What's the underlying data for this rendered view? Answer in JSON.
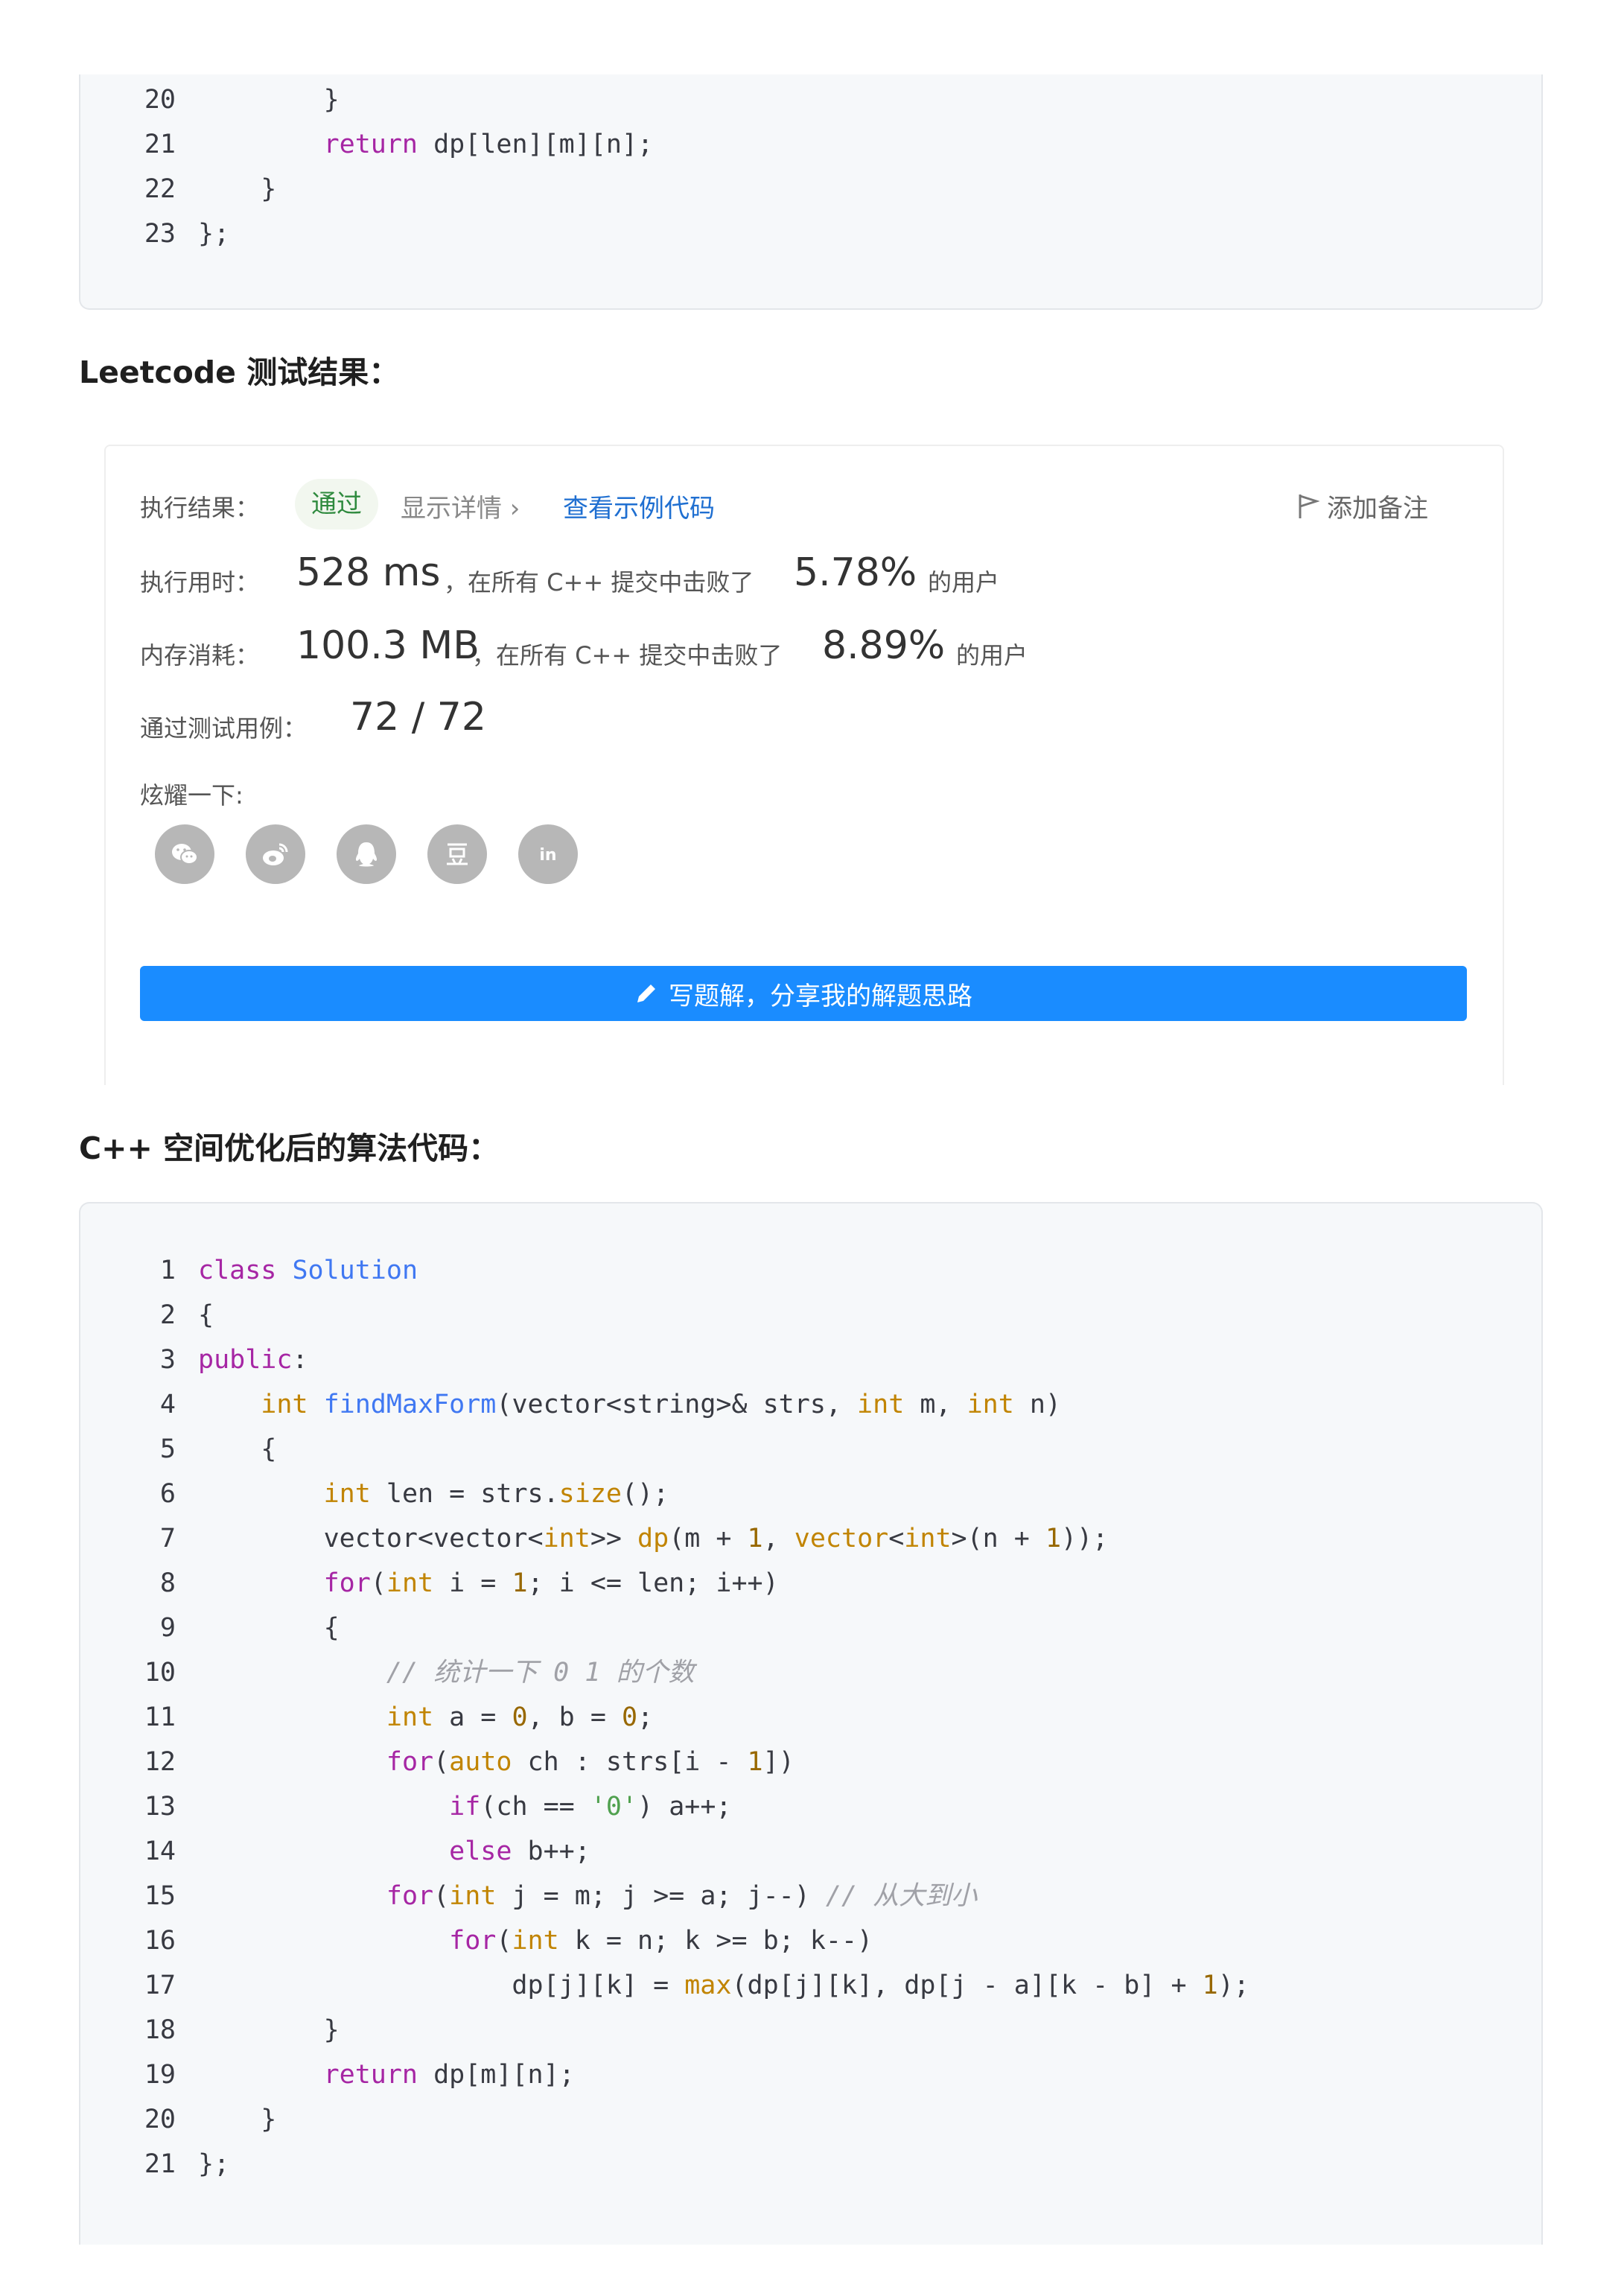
{
  "code_block_1": {
    "lines": [
      {
        "num": "20",
        "tokens": [
          {
            "t": "        }",
            "c": "pl"
          }
        ]
      },
      {
        "num": "21",
        "tokens": [
          {
            "t": "        ",
            "c": "pl"
          },
          {
            "t": "return",
            "c": "kw"
          },
          {
            "t": " dp[len][m][n];",
            "c": "pl"
          }
        ]
      },
      {
        "num": "22",
        "tokens": [
          {
            "t": "    }",
            "c": "pl"
          }
        ]
      },
      {
        "num": "23",
        "tokens": [
          {
            "t": "};",
            "c": "pl"
          }
        ]
      }
    ]
  },
  "heading_results": "Leetcode 测试结果：",
  "result_card": {
    "status_label": "执行结果：",
    "status_value": "通过",
    "details_link": "显示详情 ›",
    "sample_code_link": "查看示例代码",
    "add_note_label": "添加备注",
    "runtime_label": "执行用时：",
    "runtime_value": "528 ms",
    "runtime_mid": "，在所有 C++ 提交中击败了",
    "runtime_percent": "5.78%",
    "runtime_tail": "的用户",
    "memory_label": "内存消耗：",
    "memory_value": "100.3 MB",
    "memory_mid": "，在所有 C++ 提交中击败了",
    "memory_percent": "8.89%",
    "memory_tail": "的用户",
    "tests_label": "通过测试用例：",
    "tests_value": "72 / 72",
    "share_label": "炫耀一下:",
    "share_icons": [
      "wechat-icon",
      "weibo-icon",
      "qq-icon",
      "douban-icon",
      "linkedin-icon"
    ],
    "write_solution_label": "写题解，分享我的解题思路",
    "colors": {
      "button": "#1a8cff",
      "pass": "#2f8a3e",
      "link": "#1f6fd1"
    }
  },
  "heading_optimized": "C++ 空间优化后的算法代码：",
  "code_block_2": {
    "lines": [
      {
        "num": "1",
        "tokens": [
          {
            "t": "class",
            "c": "kw"
          },
          {
            "t": " ",
            "c": "pl"
          },
          {
            "t": "Solution",
            "c": "fn"
          }
        ]
      },
      {
        "num": "2",
        "tokens": [
          {
            "t": "{",
            "c": "pl"
          }
        ]
      },
      {
        "num": "3",
        "tokens": [
          {
            "t": "public",
            "c": "kw"
          },
          {
            "t": ":",
            "c": "pl"
          }
        ]
      },
      {
        "num": "4",
        "tokens": [
          {
            "t": "    ",
            "c": "pl"
          },
          {
            "t": "int",
            "c": "ty"
          },
          {
            "t": " ",
            "c": "pl"
          },
          {
            "t": "findMaxForm",
            "c": "fn"
          },
          {
            "t": "(vector<string>& strs, ",
            "c": "pl"
          },
          {
            "t": "int",
            "c": "ty"
          },
          {
            "t": " m, ",
            "c": "pl"
          },
          {
            "t": "int",
            "c": "ty"
          },
          {
            "t": " n)",
            "c": "pl"
          }
        ]
      },
      {
        "num": "5",
        "tokens": [
          {
            "t": "    {",
            "c": "pl"
          }
        ]
      },
      {
        "num": "6",
        "tokens": [
          {
            "t": "        ",
            "c": "pl"
          },
          {
            "t": "int",
            "c": "ty"
          },
          {
            "t": " len = strs.",
            "c": "pl"
          },
          {
            "t": "size",
            "c": "ty"
          },
          {
            "t": "();",
            "c": "pl"
          }
        ]
      },
      {
        "num": "7",
        "tokens": [
          {
            "t": "        vector<vector<",
            "c": "pl"
          },
          {
            "t": "int",
            "c": "ty"
          },
          {
            "t": ">> ",
            "c": "pl"
          },
          {
            "t": "dp",
            "c": "ty"
          },
          {
            "t": "(m + ",
            "c": "pl"
          },
          {
            "t": "1",
            "c": "nu"
          },
          {
            "t": ", ",
            "c": "pl"
          },
          {
            "t": "vector",
            "c": "ty"
          },
          {
            "t": "<",
            "c": "pl"
          },
          {
            "t": "int",
            "c": "ty"
          },
          {
            "t": ">(n + ",
            "c": "pl"
          },
          {
            "t": "1",
            "c": "nu"
          },
          {
            "t": "));",
            "c": "pl"
          }
        ]
      },
      {
        "num": "8",
        "tokens": [
          {
            "t": "        ",
            "c": "pl"
          },
          {
            "t": "for",
            "c": "kw"
          },
          {
            "t": "(",
            "c": "pl"
          },
          {
            "t": "int",
            "c": "ty"
          },
          {
            "t": " i = ",
            "c": "pl"
          },
          {
            "t": "1",
            "c": "nu"
          },
          {
            "t": "; i <= len; i++)",
            "c": "pl"
          }
        ]
      },
      {
        "num": "9",
        "tokens": [
          {
            "t": "        {",
            "c": "pl"
          }
        ]
      },
      {
        "num": "10",
        "tokens": [
          {
            "t": "            ",
            "c": "pl"
          },
          {
            "t": "// 统计一下 0 1 的个数",
            "c": "cm"
          }
        ]
      },
      {
        "num": "11",
        "tokens": [
          {
            "t": "            ",
            "c": "pl"
          },
          {
            "t": "int",
            "c": "ty"
          },
          {
            "t": " a = ",
            "c": "pl"
          },
          {
            "t": "0",
            "c": "nu"
          },
          {
            "t": ", b = ",
            "c": "pl"
          },
          {
            "t": "0",
            "c": "nu"
          },
          {
            "t": ";",
            "c": "pl"
          }
        ]
      },
      {
        "num": "12",
        "tokens": [
          {
            "t": "            ",
            "c": "pl"
          },
          {
            "t": "for",
            "c": "kw"
          },
          {
            "t": "(",
            "c": "pl"
          },
          {
            "t": "auto",
            "c": "ty"
          },
          {
            "t": " ch : strs[i - ",
            "c": "pl"
          },
          {
            "t": "1",
            "c": "nu"
          },
          {
            "t": "])",
            "c": "pl"
          }
        ]
      },
      {
        "num": "13",
        "tokens": [
          {
            "t": "                ",
            "c": "pl"
          },
          {
            "t": "if",
            "c": "kw"
          },
          {
            "t": "(ch == ",
            "c": "pl"
          },
          {
            "t": "'0'",
            "c": "st"
          },
          {
            "t": ") a++;",
            "c": "pl"
          }
        ]
      },
      {
        "num": "14",
        "tokens": [
          {
            "t": "                ",
            "c": "pl"
          },
          {
            "t": "else",
            "c": "kw"
          },
          {
            "t": " b++;",
            "c": "pl"
          }
        ]
      },
      {
        "num": "15",
        "tokens": [
          {
            "t": "            ",
            "c": "pl"
          },
          {
            "t": "for",
            "c": "kw"
          },
          {
            "t": "(",
            "c": "pl"
          },
          {
            "t": "int",
            "c": "ty"
          },
          {
            "t": " j = m; j >= a; j--) ",
            "c": "pl"
          },
          {
            "t": "// 从大到小",
            "c": "cm"
          }
        ]
      },
      {
        "num": "16",
        "tokens": [
          {
            "t": "                ",
            "c": "pl"
          },
          {
            "t": "for",
            "c": "kw"
          },
          {
            "t": "(",
            "c": "pl"
          },
          {
            "t": "int",
            "c": "ty"
          },
          {
            "t": " k = n; k >= b; k--)",
            "c": "pl"
          }
        ]
      },
      {
        "num": "17",
        "tokens": [
          {
            "t": "                    dp[j][k] = ",
            "c": "pl"
          },
          {
            "t": "max",
            "c": "ty"
          },
          {
            "t": "(dp[j][k], dp[j - a][k - b] + ",
            "c": "pl"
          },
          {
            "t": "1",
            "c": "nu"
          },
          {
            "t": ");",
            "c": "pl"
          }
        ]
      },
      {
        "num": "18",
        "tokens": [
          {
            "t": "        }",
            "c": "pl"
          }
        ]
      },
      {
        "num": "19",
        "tokens": [
          {
            "t": "        ",
            "c": "pl"
          },
          {
            "t": "return",
            "c": "kw"
          },
          {
            "t": " dp[m][n];",
            "c": "pl"
          }
        ]
      },
      {
        "num": "20",
        "tokens": [
          {
            "t": "    }",
            "c": "pl"
          }
        ]
      },
      {
        "num": "21",
        "tokens": [
          {
            "t": "};",
            "c": "pl"
          }
        ]
      }
    ]
  }
}
